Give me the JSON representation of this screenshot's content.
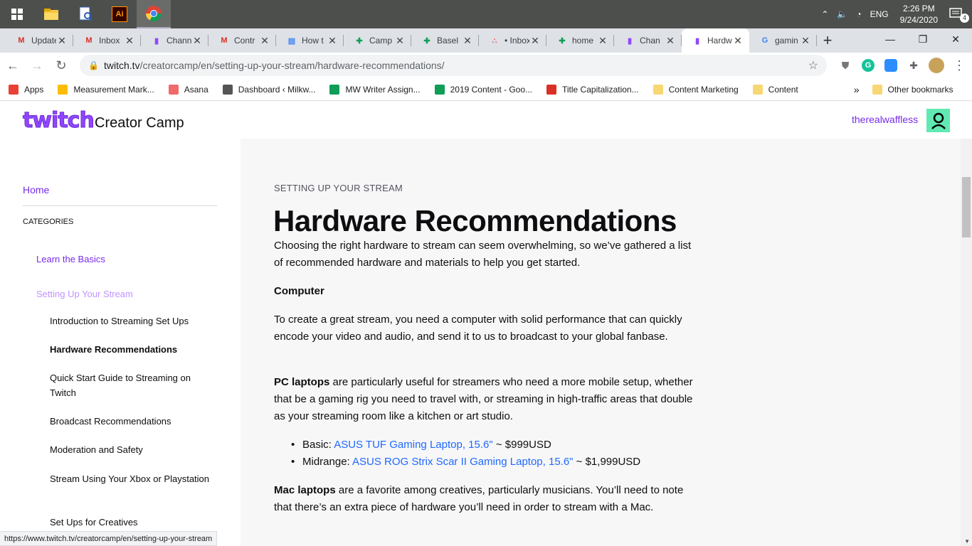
{
  "taskbar": {
    "clock_time": "2:26 PM",
    "clock_date": "9/24/2020",
    "language": "ENG",
    "notification_count": "4",
    "ai_label": "Ai"
  },
  "tabs": [
    {
      "label": "Update",
      "icon": "gmail-icon",
      "color": "#d93025"
    },
    {
      "label": "Inbox",
      "icon": "gmail-icon",
      "color": "#d93025"
    },
    {
      "label": "Channel",
      "icon": "twitch-icon",
      "color": "#9146ff"
    },
    {
      "label": "Contr",
      "icon": "gmail-icon",
      "color": "#d93025"
    },
    {
      "label": "How t",
      "icon": "docs-icon",
      "color": "#4285f4"
    },
    {
      "label": "Camp",
      "icon": "sheets-icon",
      "color": "#0f9d58"
    },
    {
      "label": "Basel",
      "icon": "sheets-icon",
      "color": "#0f9d58"
    },
    {
      "label": "• Inbox",
      "icon": "asana-icon",
      "color": "#f06a6a"
    },
    {
      "label": "home",
      "icon": "sheets-icon",
      "color": "#0f9d58"
    },
    {
      "label": "Chan",
      "icon": "twitch-icon",
      "color": "#9146ff"
    },
    {
      "label": "Hardw",
      "icon": "twitch-icon",
      "color": "#9146ff",
      "active": true
    },
    {
      "label": "gamin",
      "icon": "google-icon",
      "color": "#4285f4"
    }
  ],
  "address": {
    "domain": "twitch.tv",
    "path": "/creatorcamp/en/setting-up-your-stream/hardware-recommendations/"
  },
  "bookmarks": [
    {
      "label": "Apps",
      "color": "#e94235"
    },
    {
      "label": "Measurement Mark...",
      "color": "#fbbc04"
    },
    {
      "label": "Asana",
      "color": "#f06a6a"
    },
    {
      "label": "Dashboard ‹ Milkw...",
      "color": "#555555"
    },
    {
      "label": "MW Writer Assign...",
      "color": "#0f9d58"
    },
    {
      "label": "2019 Content - Goo...",
      "color": "#0f9d58"
    },
    {
      "label": "Title Capitalization...",
      "color": "#d93025"
    },
    {
      "label": "Content Marketing",
      "color": "#f7d774"
    },
    {
      "label": "Content",
      "color": "#f7d774"
    }
  ],
  "bookmarks_other": "Other bookmarks",
  "bookmarks_overflow": "»",
  "site": {
    "logo": "twitch",
    "title": "Creator Camp",
    "username": "therealwaffless"
  },
  "sidebar": {
    "home": "Home",
    "categories_label": "CATEGORIES",
    "learn_basics": "Learn the Basics",
    "setting_up": "Setting Up Your Stream",
    "items": [
      "Introduction to Streaming Set Ups",
      "Hardware Recommendations",
      "Quick Start Guide to Streaming on Twitch",
      "Broadcast Recommendations",
      "Moderation and Safety",
      "Stream Using Your Xbox or Playstation",
      "Set Ups for Creatives"
    ]
  },
  "article": {
    "breadcrumb": "SETTING UP YOUR STREAM",
    "title": "Hardware Recommendations",
    "intro": "Choosing the right hardware to stream can seem overwhelming, so we’ve gathered a list of recommended hardware and materials to help you get started.",
    "computer_heading": "Computer",
    "computer_para": "To create a great stream, you need a computer with solid performance that can quickly encode your video and audio, and send it to us to broadcast to your global fanbase.",
    "pc_bold": "PC laptops",
    "pc_rest": " are particularly useful for streamers who need a more mobile setup, whether that be a gaming rig you need to travel with, or streaming in high-traffic areas that double as your streaming room like a kitchen or art studio.",
    "pc_list": [
      {
        "prefix": "Basic: ",
        "link": "ASUS TUF Gaming Laptop, 15.6\"",
        "suffix": " ~ $999USD"
      },
      {
        "prefix": "Midrange: ",
        "link": "ASUS ROG Strix Scar II Gaming Laptop, 15.6\"",
        "suffix": " ~ $1,999USD"
      }
    ],
    "mac_bold": "Mac laptops",
    "mac_rest": " are a favorite among creatives, particularly musicians. You’ll need to note that there’s an extra piece of hardware you’ll need in order to stream with a Mac."
  },
  "status_url": "https://www.twitch.tv/creatorcamp/en/setting-up-your-stream",
  "colors": {
    "twitch_purple": "#9146ff",
    "link_blue": "#1f69ff",
    "avatar_green": "#61e9b4"
  }
}
